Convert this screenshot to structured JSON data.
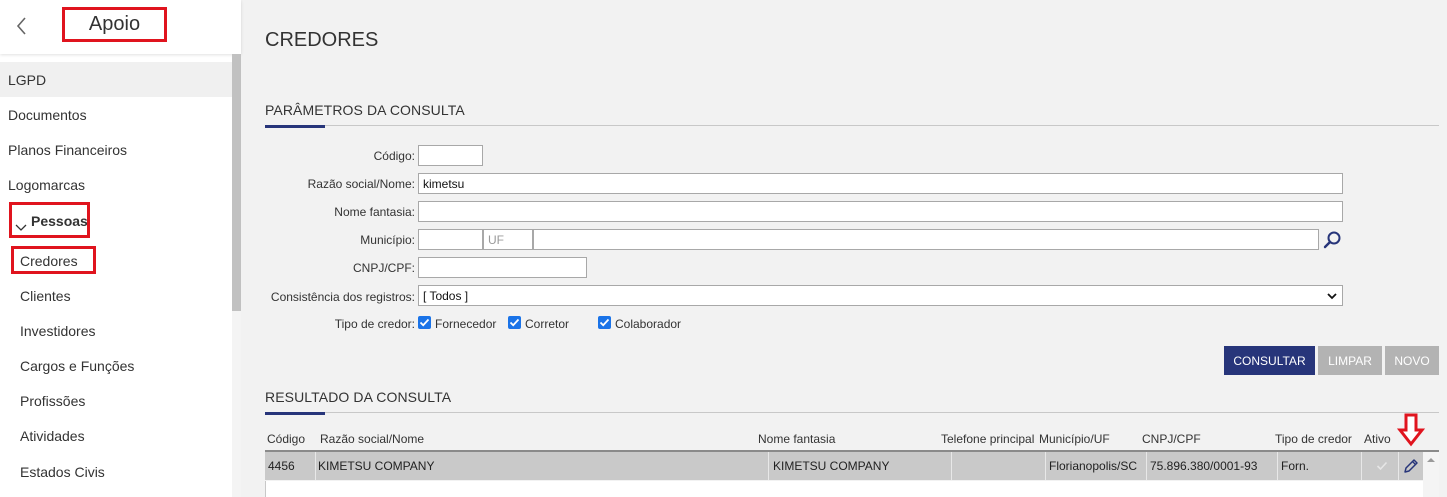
{
  "sidebar": {
    "title": "Apoio",
    "items": [
      {
        "label": "LGPD"
      },
      {
        "label": "Documentos"
      },
      {
        "label": "Planos Financeiros"
      },
      {
        "label": "Logomarcas"
      },
      {
        "label": "Pessoas"
      },
      {
        "label": "Credores"
      },
      {
        "label": "Clientes"
      },
      {
        "label": "Investidores"
      },
      {
        "label": "Cargos e Funções"
      },
      {
        "label": "Profissões"
      },
      {
        "label": "Atividades"
      },
      {
        "label": "Estados Civis"
      }
    ]
  },
  "page": {
    "title": "CREDORES"
  },
  "params": {
    "section_title": "PARÂMETROS DA CONSULTA",
    "codigo_label": "Código:",
    "codigo_value": "",
    "razao_label": "Razão social/Nome:",
    "razao_value": "kimetsu",
    "fantasia_label": "Nome fantasia:",
    "fantasia_value": "",
    "municipio_label": "Município:",
    "municipio_value": "",
    "uf_placeholder": "UF",
    "municipio_nome_value": "",
    "cnpj_label": "CNPJ/CPF:",
    "cnpj_value": "",
    "consistencia_label": "Consistência dos registros:",
    "consistencia_value": "[ Todos ]",
    "tipo_label": "Tipo de credor:",
    "tipos": [
      {
        "label": "Fornecedor",
        "checked": true
      },
      {
        "label": "Corretor",
        "checked": true
      },
      {
        "label": "Colaborador",
        "checked": true
      }
    ]
  },
  "buttons": {
    "consultar": "CONSULTAR",
    "limpar": "LIMPAR",
    "novo": "NOVO"
  },
  "results": {
    "section_title": "RESULTADO DA CONSULTA",
    "columns": [
      "Código",
      "Razão social/Nome",
      "Nome fantasia",
      "Telefone principal",
      "Município/UF",
      "CNPJ/CPF",
      "Tipo de credor",
      "Ativo"
    ],
    "rows": [
      {
        "codigo": "4456",
        "razao": "KIMETSU COMPANY",
        "fantasia": "KIMETSU COMPANY",
        "telefone": "",
        "municipio": "Florianopolis/SC",
        "cnpj": "75.896.380/0001-93",
        "tipo": "Forn.",
        "ativo": true
      }
    ]
  },
  "colors": {
    "primary": "#27357a",
    "highlight": "#e0141e",
    "checkbox": "#1a73e8",
    "disabled_button": "#b3b3b3"
  },
  "icons": [
    "chevron-left-icon",
    "chevron-down-icon",
    "search-icon",
    "check-icon",
    "edit-pencil-icon",
    "arrow-down-icon"
  ]
}
